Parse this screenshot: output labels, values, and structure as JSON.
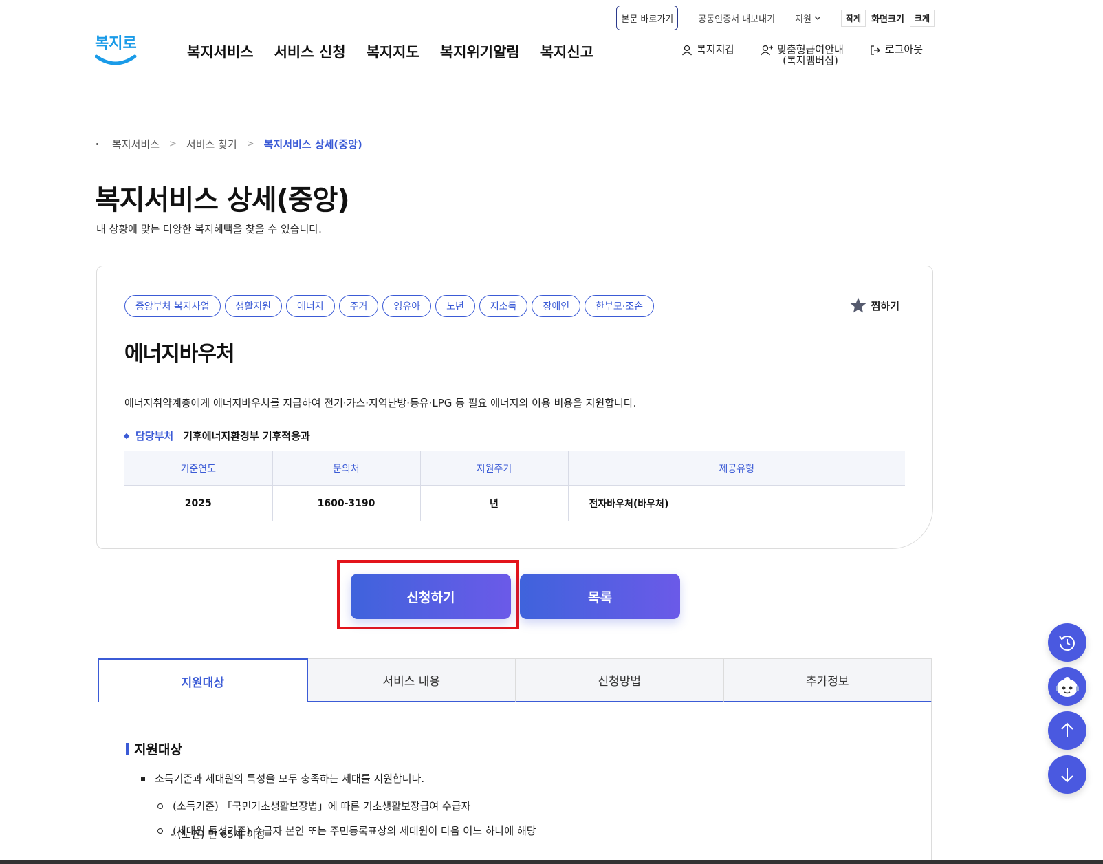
{
  "header": {
    "skip_link": "본문 바로가기",
    "cert_export": "공동인증서 내보내기",
    "support": "지원",
    "text_size": {
      "small": "작게",
      "label": "화면크기",
      "large": "크게"
    },
    "logo_text": "복지로",
    "gnb": [
      "복지서비스",
      "서비스 신청",
      "복지지도",
      "복지위기알림",
      "복지신고"
    ],
    "member": {
      "wallet": "복지지갑",
      "membership_line1": "맞춤형급여안내",
      "membership_line2": "(복지멤버십)",
      "logout": "로그아웃"
    }
  },
  "breadcrumb": [
    "복지서비스",
    "서비스 찾기",
    "복지서비스 상세(중앙)"
  ],
  "page": {
    "title": "복지서비스 상세(중앙)",
    "subtitle": "내 상황에 맞는 다양한 복지혜택을 찾을 수 있습니다."
  },
  "service": {
    "tags": [
      "중앙부처 복지사업",
      "생활지원",
      "에너지",
      "주거",
      "영유아",
      "노년",
      "저소득",
      "장애인",
      "한부모·조손"
    ],
    "favorite": "찜하기",
    "name": "에너지바우처",
    "description": "에너지취약계층에게 에너지바우처를 지급하여 전기·가스·지역난방·등유·LPG 등 필요 에너지의 이용 비용을 지원합니다.",
    "dept_label": "담당부처",
    "dept_value": "기후에너지환경부 기후적응과",
    "table": {
      "headers": [
        "기준연도",
        "문의처",
        "지원주기",
        "제공유형"
      ],
      "row": [
        "2025",
        "1600-3190",
        "년",
        "전자바우처(바우처)"
      ]
    }
  },
  "buttons": {
    "apply": "신청하기",
    "list": "목록"
  },
  "tabs": [
    "지원대상",
    "서비스 내용",
    "신청방법",
    "추가정보"
  ],
  "content": {
    "section_title": "지원대상",
    "bullet": "소득기준과 세대원의 특성을 모두 충족하는 세대를 지원합니다.",
    "sub1": "(소득기준) 「국민기초생활보장법」에 따른 기초생활보장급여 수급자",
    "sub2": "(세대원 특성기준) 수급자 본인 또는 주민등록표상의 세대원이 다음 어느 하나에 해당",
    "sub2_detail": "- (노인) 만 65세 이상"
  },
  "colors": {
    "accent": "#3b5bd6",
    "highlight": "#e3141b",
    "float": "#4a59e0"
  }
}
